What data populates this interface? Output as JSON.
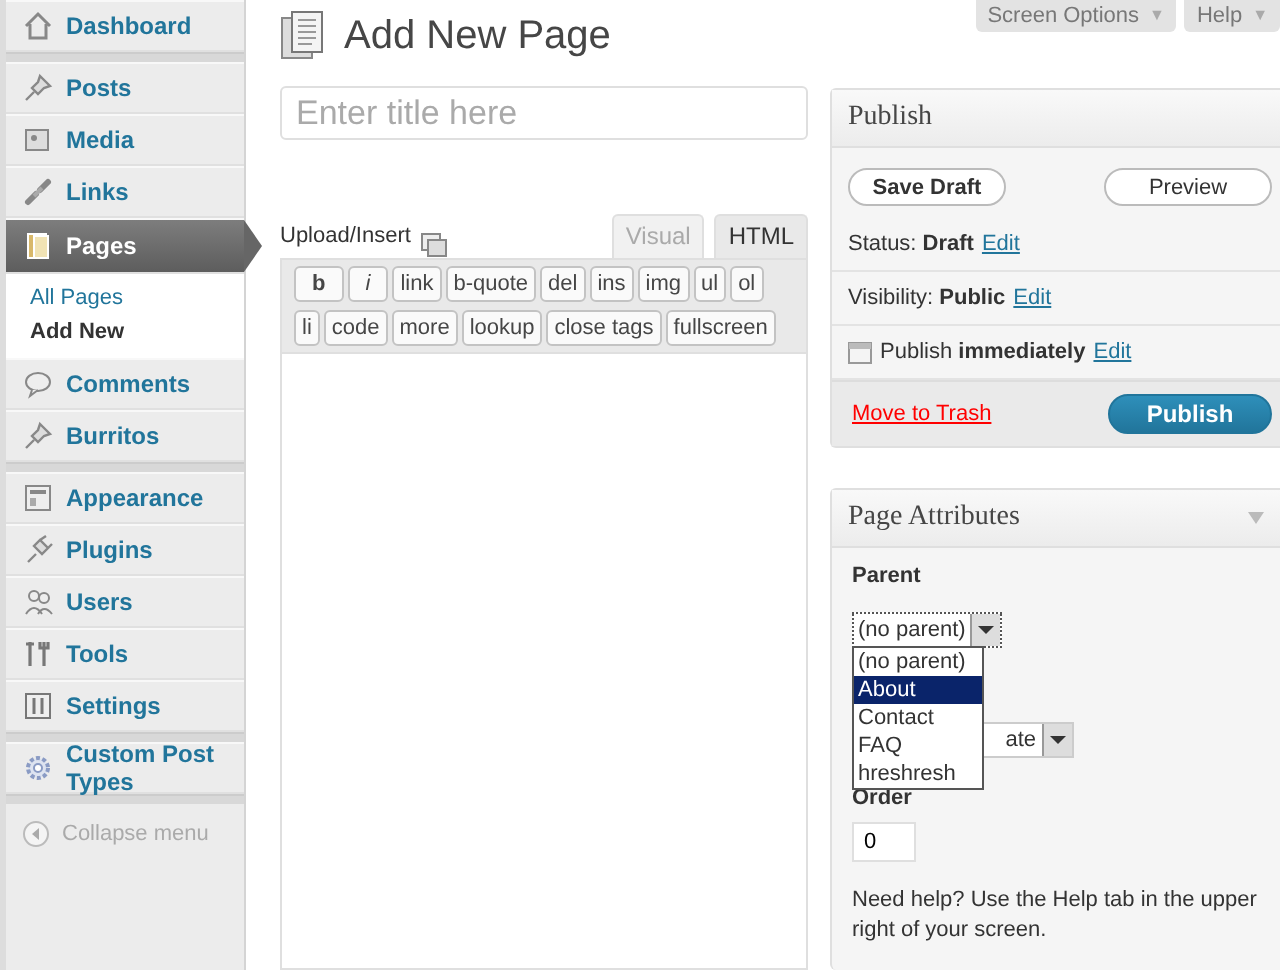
{
  "top_tabs": [
    {
      "label": "Screen Options",
      "arrow": "▼"
    },
    {
      "label": "Help",
      "arrow": "▼"
    }
  ],
  "sidebar": {
    "groups": [
      [
        {
          "label": "Dashboard",
          "selected": false
        }
      ],
      [
        {
          "label": "Posts",
          "selected": false
        },
        {
          "label": "Media",
          "selected": false
        },
        {
          "label": "Links",
          "selected": false
        },
        {
          "label": "Pages",
          "selected": true,
          "children": [
            {
              "label": "All Pages",
              "selected": false
            },
            {
              "label": "Add New",
              "selected": true
            }
          ]
        },
        {
          "label": "Comments",
          "selected": false
        },
        {
          "label": "Burritos",
          "selected": false
        }
      ],
      [
        {
          "label": "Appearance",
          "selected": false
        },
        {
          "label": "Plugins",
          "selected": false
        },
        {
          "label": "Users",
          "selected": false
        },
        {
          "label": "Tools",
          "selected": false
        },
        {
          "label": "Settings",
          "selected": false
        }
      ],
      [
        {
          "label": "Custom Post Types",
          "selected": false
        }
      ]
    ],
    "collapse": "Collapse menu"
  },
  "page_title": "Add New Page",
  "title_field": {
    "placeholder": "Enter title here"
  },
  "editor": {
    "upload_label": "Upload/Insert",
    "tabs": [
      {
        "label": "Visual",
        "selected": false
      },
      {
        "label": "HTML",
        "selected": true
      }
    ],
    "toolbar_rows": [
      [
        "b",
        "i",
        "link",
        "b-quote",
        "del",
        "ins",
        "img",
        "ul",
        "ol"
      ],
      [
        "li",
        "code",
        "more",
        "lookup",
        "close tags",
        "fullscreen"
      ]
    ]
  },
  "publish": {
    "title": "Publish",
    "save_draft": "Save Draft",
    "preview": "Preview",
    "rows": [
      {
        "text": "Status: **Draft**",
        "link": "Edit",
        "kind": "plain"
      },
      {
        "text": "Visibility: **Public**",
        "link": "Edit",
        "kind": "plain"
      },
      {
        "text": "Publish **immediately**",
        "link": "Edit",
        "kind": "calendar"
      }
    ],
    "trash": "Move to Trash",
    "publish_button": "Publish"
  },
  "page_attributes": {
    "title": "Page Attributes",
    "parent_label": "Parent",
    "parent_value": "(no parent)",
    "parent_options": [
      {
        "label": "(no parent)",
        "selected": false
      },
      {
        "label": "About",
        "selected": true
      },
      {
        "label": "Contact",
        "selected": false
      },
      {
        "label": "FAQ",
        "selected": false
      },
      {
        "label": "hreshresh",
        "selected": false
      }
    ],
    "template_value": "ate",
    "order_label": "Order",
    "order_value": "0",
    "help": "Need help? Use the Help tab in the upper right of your screen."
  }
}
